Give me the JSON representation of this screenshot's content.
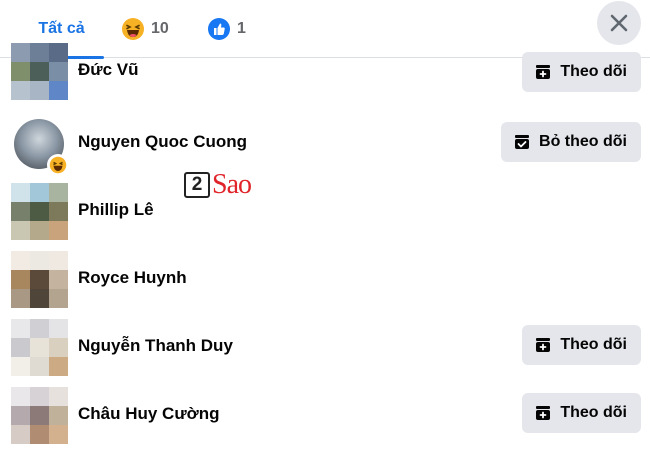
{
  "tabs": {
    "all_label": "Tất cả",
    "haha_count": "10",
    "like_count": "1"
  },
  "people": [
    {
      "name": "Đức Vũ",
      "button": "Theo dõi",
      "button_state": "follow",
      "pixels": [
        "#8c9bb0",
        "#6d7f97",
        "#5a6b88",
        "#7f8f6b",
        "#4c5f58",
        "#7a8fa5",
        "#b7c2cf",
        "#a8b5c4",
        "#5f86c7"
      ]
    },
    {
      "name": "Nguyen Quoc Cuong",
      "button": "Bỏ theo dõi",
      "button_state": "unfollow"
    },
    {
      "name": "Phillip Lê",
      "button": "",
      "button_state": "none",
      "pixels": [
        "#d0e2ea",
        "#a2c7d8",
        "#a8b3a0",
        "#77806a",
        "#4d5a44",
        "#7c7a5a",
        "#c9c6b2",
        "#b5a98c",
        "#c8a37b"
      ]
    },
    {
      "name": "Royce Huynh",
      "button": "",
      "button_state": "none",
      "pixels": [
        "#f2ebe4",
        "#ece8e2",
        "#f0e9e2",
        "#a8865e",
        "#5b4a3a",
        "#c3b39f",
        "#a89884",
        "#4f4639",
        "#b2a48f"
      ]
    },
    {
      "name": "Nguyễn Thanh Duy",
      "button": "Theo dõi",
      "button_state": "follow",
      "pixels": [
        "#e8e8ea",
        "#cfcfd4",
        "#e4e4e7",
        "#c9c9ce",
        "#e7e3d8",
        "#d9d0c0",
        "#f2efe9",
        "#e0dbd2",
        "#ccaa84"
      ]
    },
    {
      "name": "Châu Huy Cường",
      "button": "Theo dõi",
      "button_state": "follow",
      "pixels": [
        "#e9e7ea",
        "#d6d2d6",
        "#e6e1dd",
        "#b4a9ad",
        "#8b7a78",
        "#c0b29a",
        "#d7cbc6",
        "#b08c73",
        "#d4b18e"
      ]
    }
  ],
  "watermark": {
    "number": "2",
    "text": "Sao"
  },
  "colors": {
    "accent": "#1b74e4",
    "button_bg": "#e4e6eb",
    "haha": "#f7b125",
    "like": "#1877f2"
  }
}
